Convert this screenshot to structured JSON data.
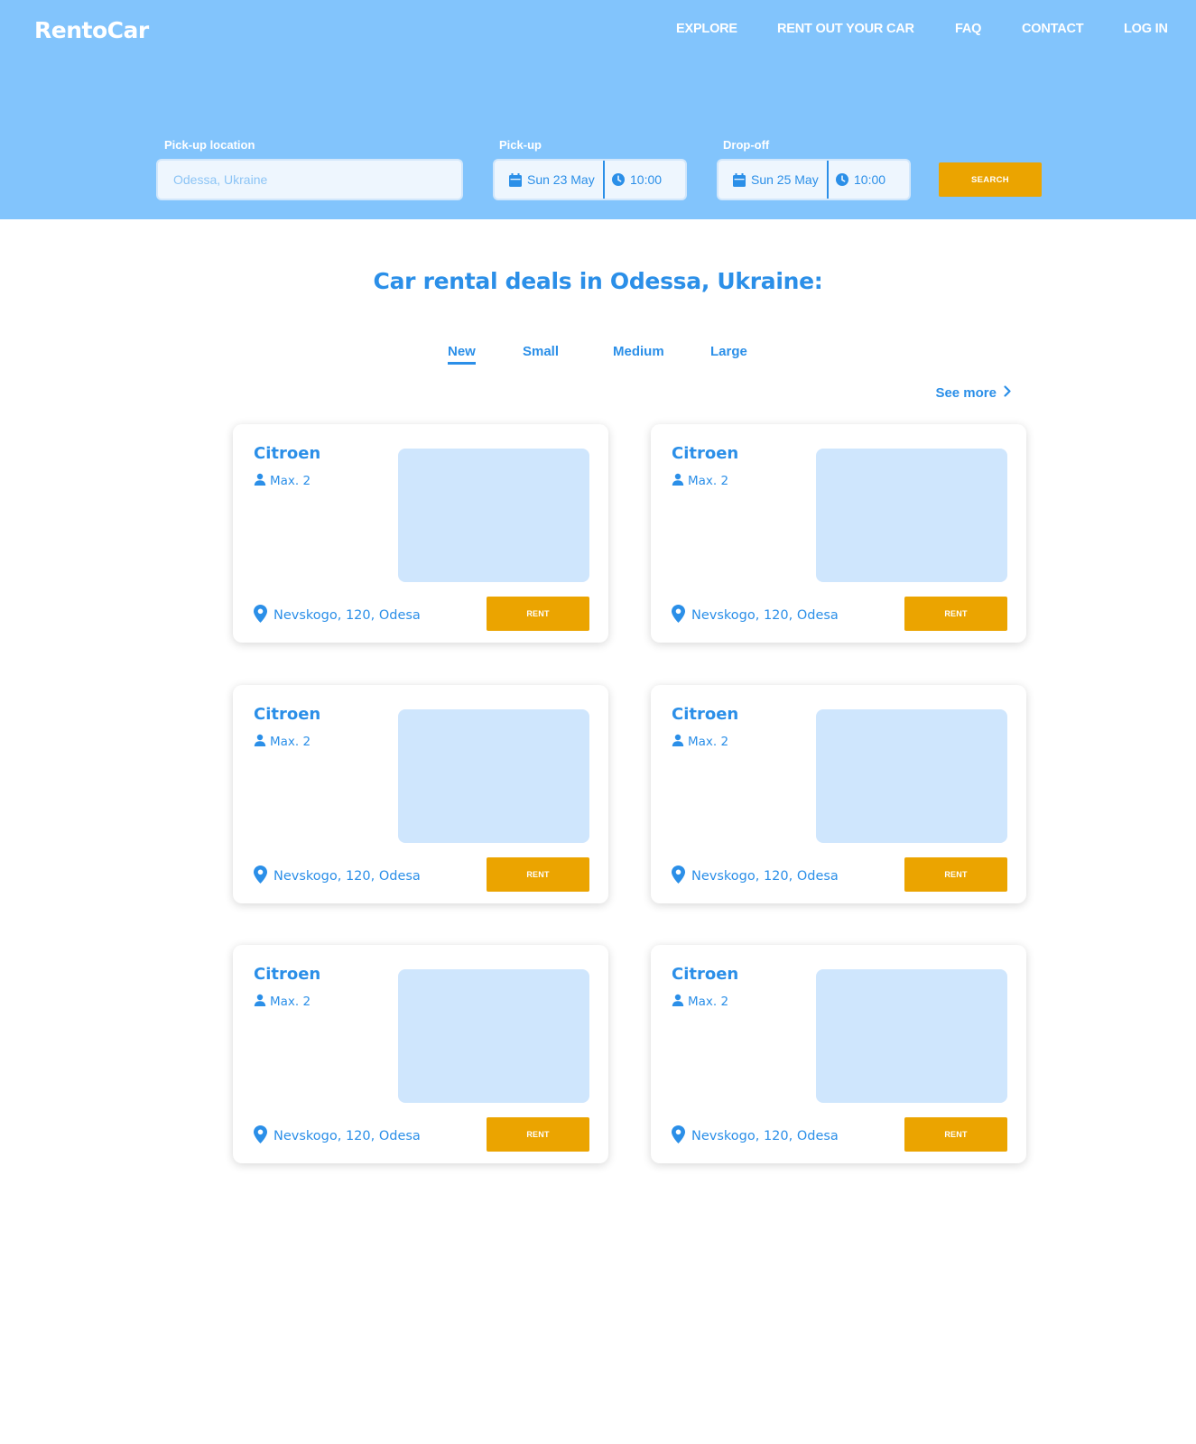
{
  "header": {
    "logo": "RentoCar",
    "nav": [
      "EXPLORE",
      "RENT OUT YOUR CAR",
      "FAQ",
      "CONTACT",
      "LOG IN"
    ]
  },
  "search": {
    "location_label": "Pick-up location",
    "location_placeholder": "Odessa, Ukraine",
    "pickup_label": "Pick-up",
    "pickup_date": "Sun 23 May",
    "pickup_time": "10:00",
    "dropoff_label": "Drop-off",
    "dropoff_date": "Sun 25 May",
    "dropoff_time": "10:00",
    "button": "SEARCH"
  },
  "main": {
    "title": "Car rental deals in Odessa, Ukraine:",
    "tabs": [
      "New",
      "Small",
      "Medium",
      "Large"
    ],
    "active_tab": "New",
    "see_more": "See more"
  },
  "cars": [
    {
      "model": "Citroen",
      "seats": "Max. 2",
      "location": "Nevskogo, 120, Odesa",
      "button": "RENT"
    },
    {
      "model": "Citroen",
      "seats": "Max. 2",
      "location": "Nevskogo, 120, Odesa",
      "button": "RENT"
    },
    {
      "model": "Citroen",
      "seats": "Max. 2",
      "location": "Nevskogo, 120, Odesa",
      "button": "RENT"
    },
    {
      "model": "Citroen",
      "seats": "Max. 2",
      "location": "Nevskogo, 120, Odesa",
      "button": "RENT"
    },
    {
      "model": "Citroen",
      "seats": "Max. 2",
      "location": "Nevskogo, 120, Odesa",
      "button": "RENT"
    },
    {
      "model": "Citroen",
      "seats": "Max. 2",
      "location": "Nevskogo, 120, Odesa",
      "button": "RENT"
    }
  ],
  "icons": {
    "calendar": "calendar-icon",
    "clock": "clock-icon",
    "person": "person-icon",
    "location_pin": "location-pin-icon",
    "chevron_right": "chevron-right-icon"
  },
  "colors": {
    "header_bg": "#82c4fc",
    "primary_blue": "#2b8fe8",
    "accent_orange": "#eba400",
    "image_placeholder": "#cfe6fd"
  }
}
